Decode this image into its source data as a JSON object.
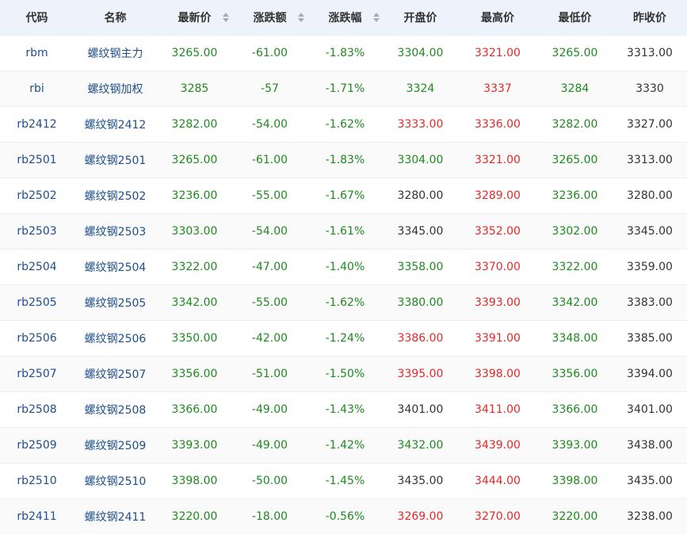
{
  "colors": {
    "rise": "#e62828",
    "fall": "#1e8a1e",
    "flat": "#333333",
    "link": "#1e4f8a",
    "header_bg": "#eef2fb"
  },
  "icons": {
    "sort": "sort-caret-icon"
  },
  "table": {
    "headers": [
      "代码",
      "名称",
      "最新价",
      "涨跌额",
      "涨跌幅",
      "开盘价",
      "最高价",
      "最低价",
      "昨收价"
    ],
    "rows": [
      {
        "code": "rbm",
        "name": "螺纹钢主力",
        "latest": "3265.00",
        "change": "-61.00",
        "pct": "-1.83%",
        "open": "3304.00",
        "high": "3321.00",
        "low": "3265.00",
        "prev_close": "3313.00"
      },
      {
        "code": "rbi",
        "name": "螺纹钢加权",
        "latest": "3285",
        "change": "-57",
        "pct": "-1.71%",
        "open": "3324",
        "high": "3337",
        "low": "3284",
        "prev_close": "3330"
      },
      {
        "code": "rb2412",
        "name": "螺纹钢2412",
        "latest": "3282.00",
        "change": "-54.00",
        "pct": "-1.62%",
        "open": "3333.00",
        "high": "3336.00",
        "low": "3282.00",
        "prev_close": "3327.00"
      },
      {
        "code": "rb2501",
        "name": "螺纹钢2501",
        "latest": "3265.00",
        "change": "-61.00",
        "pct": "-1.83%",
        "open": "3304.00",
        "high": "3321.00",
        "low": "3265.00",
        "prev_close": "3313.00"
      },
      {
        "code": "rb2502",
        "name": "螺纹钢2502",
        "latest": "3236.00",
        "change": "-55.00",
        "pct": "-1.67%",
        "open": "3280.00",
        "high": "3289.00",
        "low": "3236.00",
        "prev_close": "3280.00"
      },
      {
        "code": "rb2503",
        "name": "螺纹钢2503",
        "latest": "3303.00",
        "change": "-54.00",
        "pct": "-1.61%",
        "open": "3345.00",
        "high": "3352.00",
        "low": "3302.00",
        "prev_close": "3345.00"
      },
      {
        "code": "rb2504",
        "name": "螺纹钢2504",
        "latest": "3322.00",
        "change": "-47.00",
        "pct": "-1.40%",
        "open": "3358.00",
        "high": "3370.00",
        "low": "3322.00",
        "prev_close": "3359.00"
      },
      {
        "code": "rb2505",
        "name": "螺纹钢2505",
        "latest": "3342.00",
        "change": "-55.00",
        "pct": "-1.62%",
        "open": "3380.00",
        "high": "3393.00",
        "low": "3342.00",
        "prev_close": "3383.00"
      },
      {
        "code": "rb2506",
        "name": "螺纹钢2506",
        "latest": "3350.00",
        "change": "-42.00",
        "pct": "-1.24%",
        "open": "3386.00",
        "high": "3391.00",
        "low": "3348.00",
        "prev_close": "3385.00"
      },
      {
        "code": "rb2507",
        "name": "螺纹钢2507",
        "latest": "3356.00",
        "change": "-51.00",
        "pct": "-1.50%",
        "open": "3395.00",
        "high": "3398.00",
        "low": "3356.00",
        "prev_close": "3394.00"
      },
      {
        "code": "rb2508",
        "name": "螺纹钢2508",
        "latest": "3366.00",
        "change": "-49.00",
        "pct": "-1.43%",
        "open": "3401.00",
        "high": "3411.00",
        "low": "3366.00",
        "prev_close": "3401.00"
      },
      {
        "code": "rb2509",
        "name": "螺纹钢2509",
        "latest": "3393.00",
        "change": "-49.00",
        "pct": "-1.42%",
        "open": "3432.00",
        "high": "3439.00",
        "low": "3393.00",
        "prev_close": "3438.00"
      },
      {
        "code": "rb2510",
        "name": "螺纹钢2510",
        "latest": "3398.00",
        "change": "-50.00",
        "pct": "-1.45%",
        "open": "3435.00",
        "high": "3444.00",
        "low": "3398.00",
        "prev_close": "3435.00"
      },
      {
        "code": "rb2411",
        "name": "螺纹钢2411",
        "latest": "3220.00",
        "change": "-18.00",
        "pct": "-0.56%",
        "open": "3269.00",
        "high": "3270.00",
        "low": "3220.00",
        "prev_close": "3238.00"
      }
    ]
  }
}
